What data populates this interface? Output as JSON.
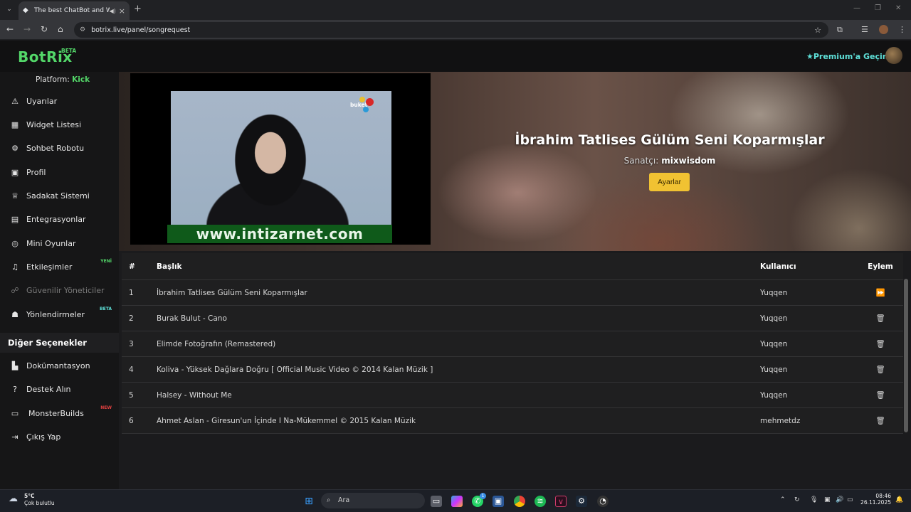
{
  "browser": {
    "tab_title": "The best ChatBot and Widg",
    "url": "botrix.live/panel/songrequest",
    "new_tab": "+",
    "tab_close": "×"
  },
  "app": {
    "logo": "BotRix",
    "beta": "BETA",
    "premium": "Premium'a Geçin",
    "platform_label": "Platform:",
    "platform_value": "Kick"
  },
  "sidebar": {
    "items": [
      {
        "label": "Uyarılar",
        "icon": "warning-icon"
      },
      {
        "label": "Widget Listesi",
        "icon": "grid-icon"
      },
      {
        "label": "Sohbet Robotu",
        "icon": "robot-icon"
      },
      {
        "label": "Profil",
        "icon": "id-card-icon"
      },
      {
        "label": "Sadakat Sistemi",
        "icon": "trophy-icon"
      },
      {
        "label": "Entegrasyonlar",
        "icon": "plug-icon"
      },
      {
        "label": "Mini Oyunlar",
        "icon": "gamepad-icon"
      },
      {
        "label": "Etkileşimler",
        "icon": "music-icon",
        "badge": "YENİ"
      },
      {
        "label": "Güvenilir Yöneticiler",
        "icon": "users-cog-icon",
        "disabled": true
      },
      {
        "label": "Yönlendirmeler",
        "icon": "user-group-icon",
        "badge": "BETA"
      }
    ],
    "other_heading": "Diğer Seçenekler",
    "other_items": [
      {
        "label": "Dokümantasyon",
        "icon": "book-icon"
      },
      {
        "label": "Destek Alın",
        "icon": "question-icon"
      },
      {
        "label": "MonsterBuilds",
        "icon": "monitor-icon",
        "badge": "NEW"
      },
      {
        "label": "Çıkış Yap",
        "icon": "sign-out-icon"
      }
    ]
  },
  "player": {
    "song_title": "İbrahim Tatlises Gülüm Seni Koparmışlar",
    "artist_label": "Sanatçı:",
    "artist_name": "mixwisdom",
    "settings_button": "Ayarlar",
    "video_watermark": "www.intizarnet.com",
    "channel_logo": "buket"
  },
  "queue": {
    "headers": {
      "num": "#",
      "title": "Başlık",
      "user": "Kullanıcı",
      "action": "Eylem"
    },
    "rows": [
      {
        "num": "1",
        "title": "İbrahim Tatlises Gülüm Seni Koparmışlar",
        "user": "Yuqqen",
        "action": "skip-icon"
      },
      {
        "num": "2",
        "title": "Burak Bulut - Cano",
        "user": "Yuqqen",
        "action": "trash-icon"
      },
      {
        "num": "3",
        "title": "Elimde Fotoğrafın (Remastered)",
        "user": "Yuqqen",
        "action": "trash-icon"
      },
      {
        "num": "4",
        "title": "Koliva - Yüksek Dağlara Doğru [ Official Music Video © 2014 Kalan Müzik ]",
        "user": "Yuqqen",
        "action": "trash-icon"
      },
      {
        "num": "5",
        "title": "Halsey - Without Me",
        "user": "Yuqqen",
        "action": "trash-icon"
      },
      {
        "num": "6",
        "title": "Ahmet Aslan - Giresun'un İçinde I Na-Mükemmel © 2015 Kalan Müzik",
        "user": "mehmetdz",
        "action": "trash-icon"
      }
    ]
  },
  "taskbar": {
    "weather_temp": "5°C",
    "weather_desc": "Çok bulutlu",
    "search_placeholder": "Ara",
    "time": "08:46",
    "date": "26.11.2025",
    "whatsapp_badge": "1"
  }
}
